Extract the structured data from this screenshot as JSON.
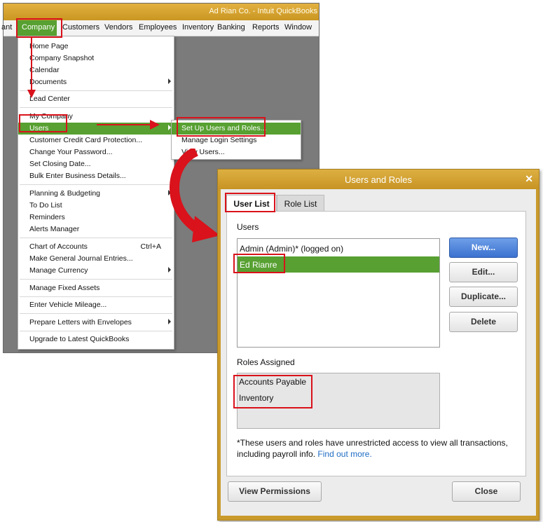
{
  "colors": {
    "accent_green": "#57a031",
    "title_gold": "#c99a2c",
    "annotation_red": "#d9121b",
    "link_blue": "#1f6dc4"
  },
  "qb_window": {
    "title": "Ad Rian Co.  - Intuit QuickBooks",
    "menubar": [
      "ant",
      "Company",
      "Customers",
      "Vendors",
      "Employees",
      "Inventory",
      "Banking",
      "Reports",
      "Window"
    ]
  },
  "company_menu": {
    "items": [
      {
        "label": "Home Page"
      },
      {
        "label": "Company Snapshot"
      },
      {
        "label": "Calendar"
      },
      {
        "label": "Documents",
        "submenu": true
      },
      {
        "label": "Lead Center"
      },
      {
        "label": "My Company"
      },
      {
        "label": "Users",
        "submenu": true,
        "highlighted": true
      },
      {
        "label": "Customer Credit Card Protection..."
      },
      {
        "label": "Change Your Password..."
      },
      {
        "label": "Set Closing Date..."
      },
      {
        "label": "Bulk Enter Business Details..."
      },
      {
        "label": "Planning & Budgeting",
        "submenu": true
      },
      {
        "label": "To Do List"
      },
      {
        "label": "Reminders"
      },
      {
        "label": "Alerts Manager"
      },
      {
        "label": "Chart of Accounts",
        "shortcut": "Ctrl+A"
      },
      {
        "label": "Make General Journal Entries..."
      },
      {
        "label": "Manage Currency",
        "submenu": true
      },
      {
        "label": "Manage Fixed Assets"
      },
      {
        "label": "Enter Vehicle Mileage..."
      },
      {
        "label": "Prepare Letters with Envelopes",
        "submenu": true
      },
      {
        "label": "Upgrade to Latest QuickBooks"
      }
    ]
  },
  "users_submenu": {
    "items": [
      {
        "label": "Set Up Users and Roles...",
        "highlighted": true
      },
      {
        "label": "Manage Login Settings"
      },
      {
        "label": "View Users..."
      }
    ]
  },
  "dialog": {
    "title": "Users and Roles",
    "close_glyph": "✕",
    "tabs": [
      "User List",
      "Role List"
    ],
    "users_label": "Users",
    "users": [
      "Admin (Admin)* (logged on)",
      "Ed Rianre"
    ],
    "selected_user": "Ed Rianre",
    "buttons": {
      "new": "New...",
      "edit": "Edit...",
      "duplicate": "Duplicate...",
      "delete": "Delete"
    },
    "roles_label": "Roles Assigned",
    "roles": [
      "Accounts Payable",
      "Inventory"
    ],
    "footnote": "*These users and roles have unrestricted access to view all transactions, including payroll info.",
    "find_out_more": "Find out more.",
    "view_permissions": "View Permissions",
    "close": "Close"
  }
}
